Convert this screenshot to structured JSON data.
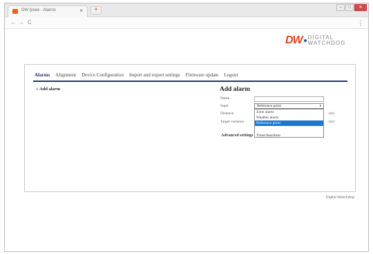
{
  "browser": {
    "tab_title": "DW Ipsee - Alarms",
    "tab_close": "×",
    "new_tab": "+",
    "back": "←",
    "forward": "→",
    "reload": "C",
    "menu": "⋮",
    "win_minimize": "–",
    "win_maximize": "□",
    "win_close": "✕"
  },
  "logo": {
    "mark": "DW",
    "line1": "DIGITAL",
    "line2": "WATCHDOG"
  },
  "menu": {
    "items": [
      {
        "label": "Alarms",
        "active": true
      },
      {
        "label": "Alignment",
        "active": false
      },
      {
        "label": "Device Configuration",
        "active": false
      },
      {
        "label": "Import and export settings",
        "active": false
      },
      {
        "label": "Firmware update",
        "active": false
      },
      {
        "label": "Logout",
        "active": false
      }
    ]
  },
  "add_alarm_link": "+ Add alarm",
  "form": {
    "title": "Add alarm",
    "name_label": "Name",
    "name_value": "",
    "input_label": "Input",
    "input_selected": "Reference point",
    "input_caret": "▾",
    "distance_label": "Distance",
    "distance_unit": "(m)",
    "target_variance_label": "Target variance",
    "target_variance_unit": "(m)",
    "advanced_label": "Advanced settings",
    "options": [
      {
        "label": "Zone alarm",
        "selected": false
      },
      {
        "label": "Weather alarm",
        "selected": false
      },
      {
        "label": "Reference point",
        "selected": true
      },
      {
        "label": "",
        "selected": false
      },
      {
        "label": "Timer/heartbeat",
        "selected": false
      }
    ]
  },
  "footer": "Digital Watchdog",
  "colors": {
    "accent_rule": "#25356f",
    "logo_red": "#e04414",
    "selected_option": "#1a77d4"
  }
}
